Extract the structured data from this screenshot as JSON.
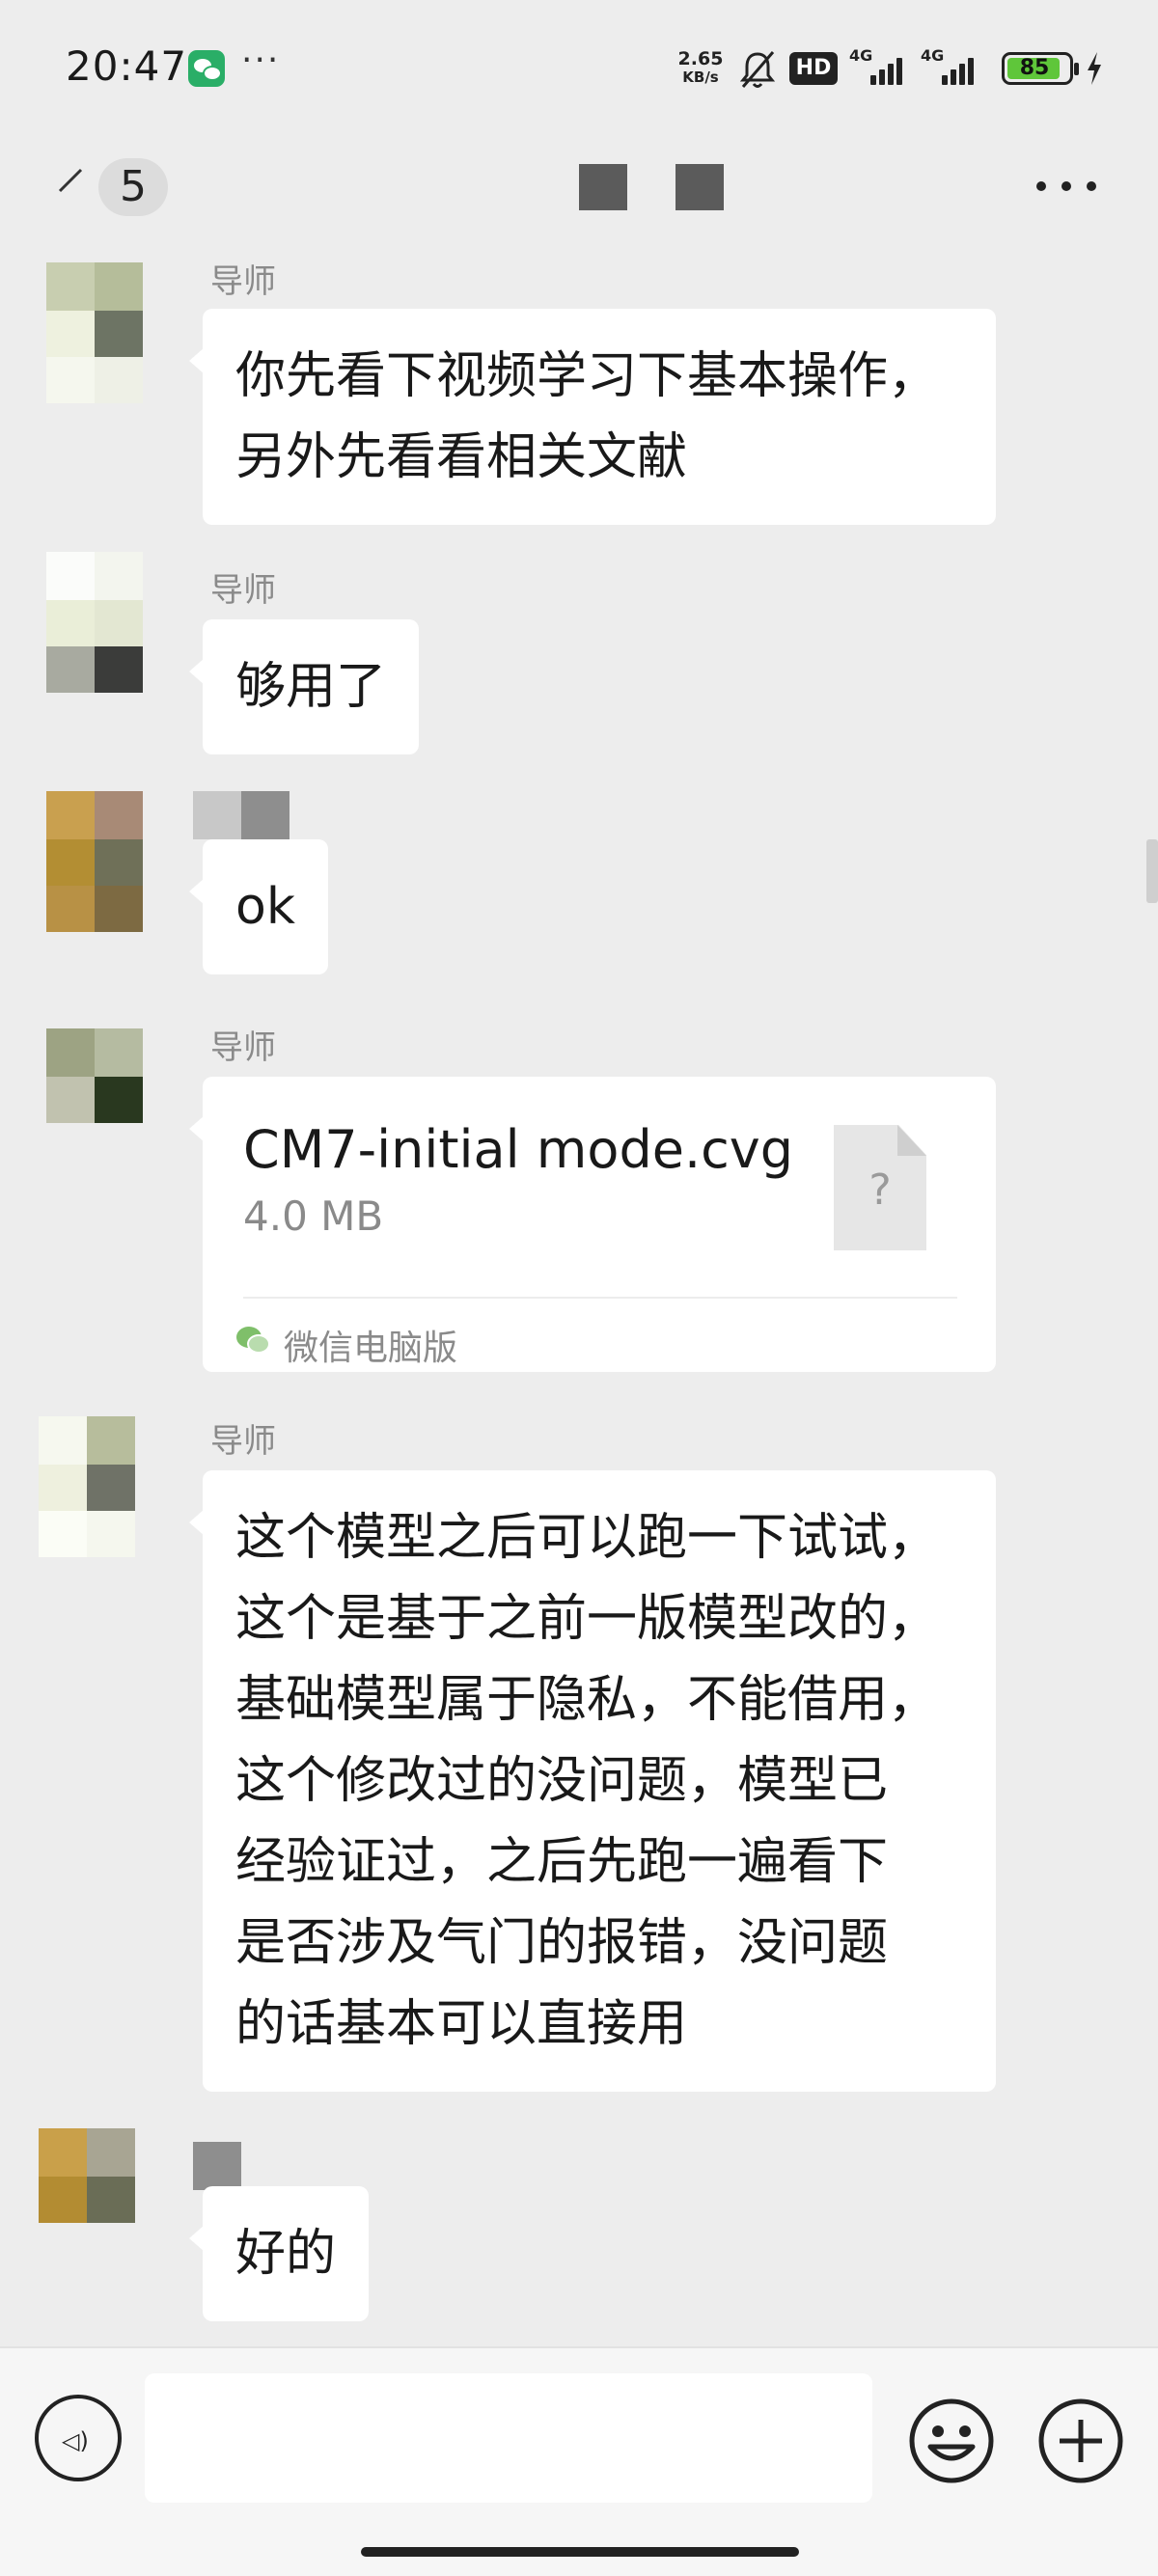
{
  "status_bar": {
    "time": "20:47",
    "net_speed": "2.65",
    "net_unit": "KB/s",
    "hd_label": "HD",
    "signal_1": "4G",
    "signal_2": "4G",
    "battery": "85",
    "overflow": "···"
  },
  "nav": {
    "unread_count": "5"
  },
  "messages": [
    {
      "sender": "导师",
      "lines": [
        "你先看下视频学习下基本操作，",
        "另外先看看相关文献"
      ]
    },
    {
      "sender": "导师",
      "lines": [
        "够用了"
      ]
    },
    {
      "sender": "",
      "lines": [
        "ok"
      ]
    },
    {
      "sender": "导师",
      "file": {
        "name": "CM7-initial mode.cvg",
        "size": "4.0 MB",
        "placeholder": "?",
        "source": "微信电脑版"
      }
    },
    {
      "sender": "导师",
      "lines": [
        "这个模型之后可以跑一下试试，",
        "这个是基于之前一版模型改的，",
        "基础模型属于隐私，不能借用，",
        "这个修改过的没问题，模型已",
        "经验证过，之后先跑一遍看下",
        "是否涉及气门的报错，没问题",
        "的话基本可以直接用"
      ]
    },
    {
      "sender": "",
      "lines": [
        "好的"
      ]
    }
  ],
  "colors": {
    "background": "#ededed",
    "bubble": "#ffffff",
    "sender_text": "#8a8a8a",
    "wechat_green": "#2aae67",
    "battery_green": "#5fc63a"
  },
  "icons": {
    "voice": "voice-icon",
    "emoji": "emoji-icon",
    "plus": "plus-icon",
    "more": "more-icon",
    "file": "file-unknown-icon"
  }
}
